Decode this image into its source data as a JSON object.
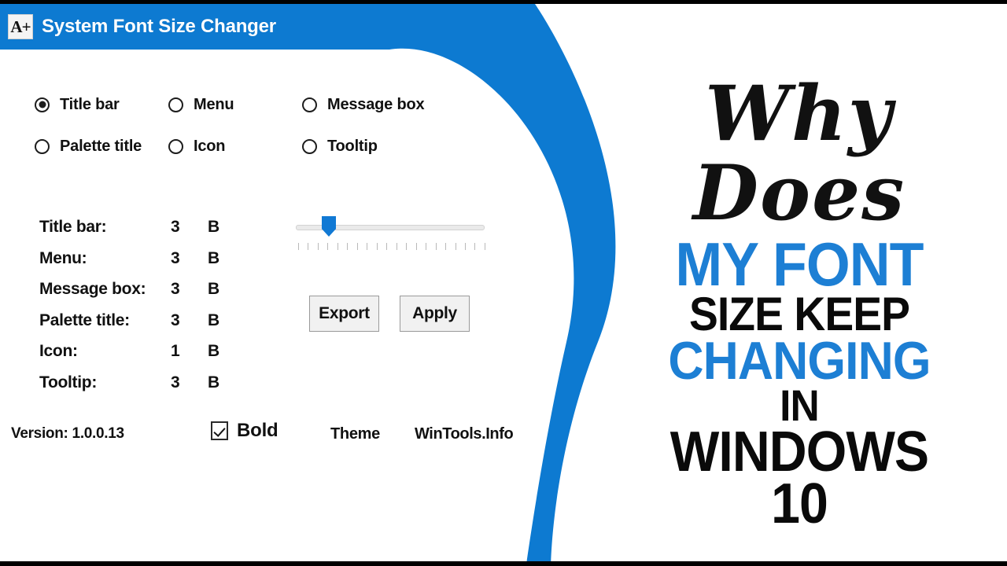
{
  "colors": {
    "brand_blue": "#0d7ad1",
    "promo_blue": "#1d7fd4",
    "text_black": "#111111",
    "window_bg": "#ffffff"
  },
  "window": {
    "icon_name": "a-plus-icon",
    "icon_glyph": "A+",
    "title": "System Font Size Changer"
  },
  "radio_group": {
    "selected": "Title bar",
    "options": [
      {
        "label": "Title bar",
        "checked": true
      },
      {
        "label": "Menu",
        "checked": false
      },
      {
        "label": "Message box",
        "checked": false
      },
      {
        "label": "Palette title",
        "checked": false
      },
      {
        "label": "Icon",
        "checked": false
      },
      {
        "label": "Tooltip",
        "checked": false
      }
    ]
  },
  "values": {
    "bold_flag": "B",
    "rows": [
      {
        "name": "Title bar:",
        "size": "3",
        "bold": "B"
      },
      {
        "name": "Menu:",
        "size": "3",
        "bold": "B"
      },
      {
        "name": "Message box:",
        "size": "3",
        "bold": "B"
      },
      {
        "name": "Palette title:",
        "size": "3",
        "bold": "B"
      },
      {
        "name": "Icon:",
        "size": "1",
        "bold": "B"
      },
      {
        "name": "Tooltip:",
        "size": "3",
        "bold": "B"
      }
    ]
  },
  "slider": {
    "value": 3,
    "min": 0,
    "max": 19,
    "tick_count": 20
  },
  "buttons": {
    "export_label": "Export",
    "apply_label": "Apply"
  },
  "footer": {
    "version_label": "Version: 1.0.0.13",
    "bold_label": "Bold",
    "bold_checked": true,
    "theme_label": "Theme",
    "site_label": "WinTools.Info"
  },
  "promo": {
    "script_line": "Why Does",
    "line1": "MY FONT",
    "line2": "SIZE KEEP",
    "line3": "CHANGING",
    "line4": "IN",
    "line5": "WINDOWS 10"
  }
}
